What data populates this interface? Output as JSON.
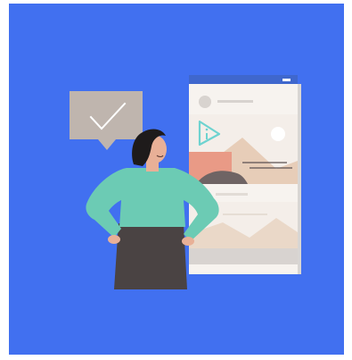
{
  "illustration": {
    "background_color": "#4170F0",
    "icons": {
      "speech_bubble": "checkmark-speech-bubble-icon",
      "play": "play-icon"
    },
    "colors": {
      "bubble": "#BFB5AE",
      "check": "#FFFFFF",
      "browser_header": "#3F67CD",
      "browser_panel": "#F7F3EF",
      "shirt": "#6CCBB4",
      "pants": "#4A4343",
      "hair": "#1E1B1B",
      "skin": "#E8B097",
      "play_icon": "#6ED3D0"
    }
  }
}
